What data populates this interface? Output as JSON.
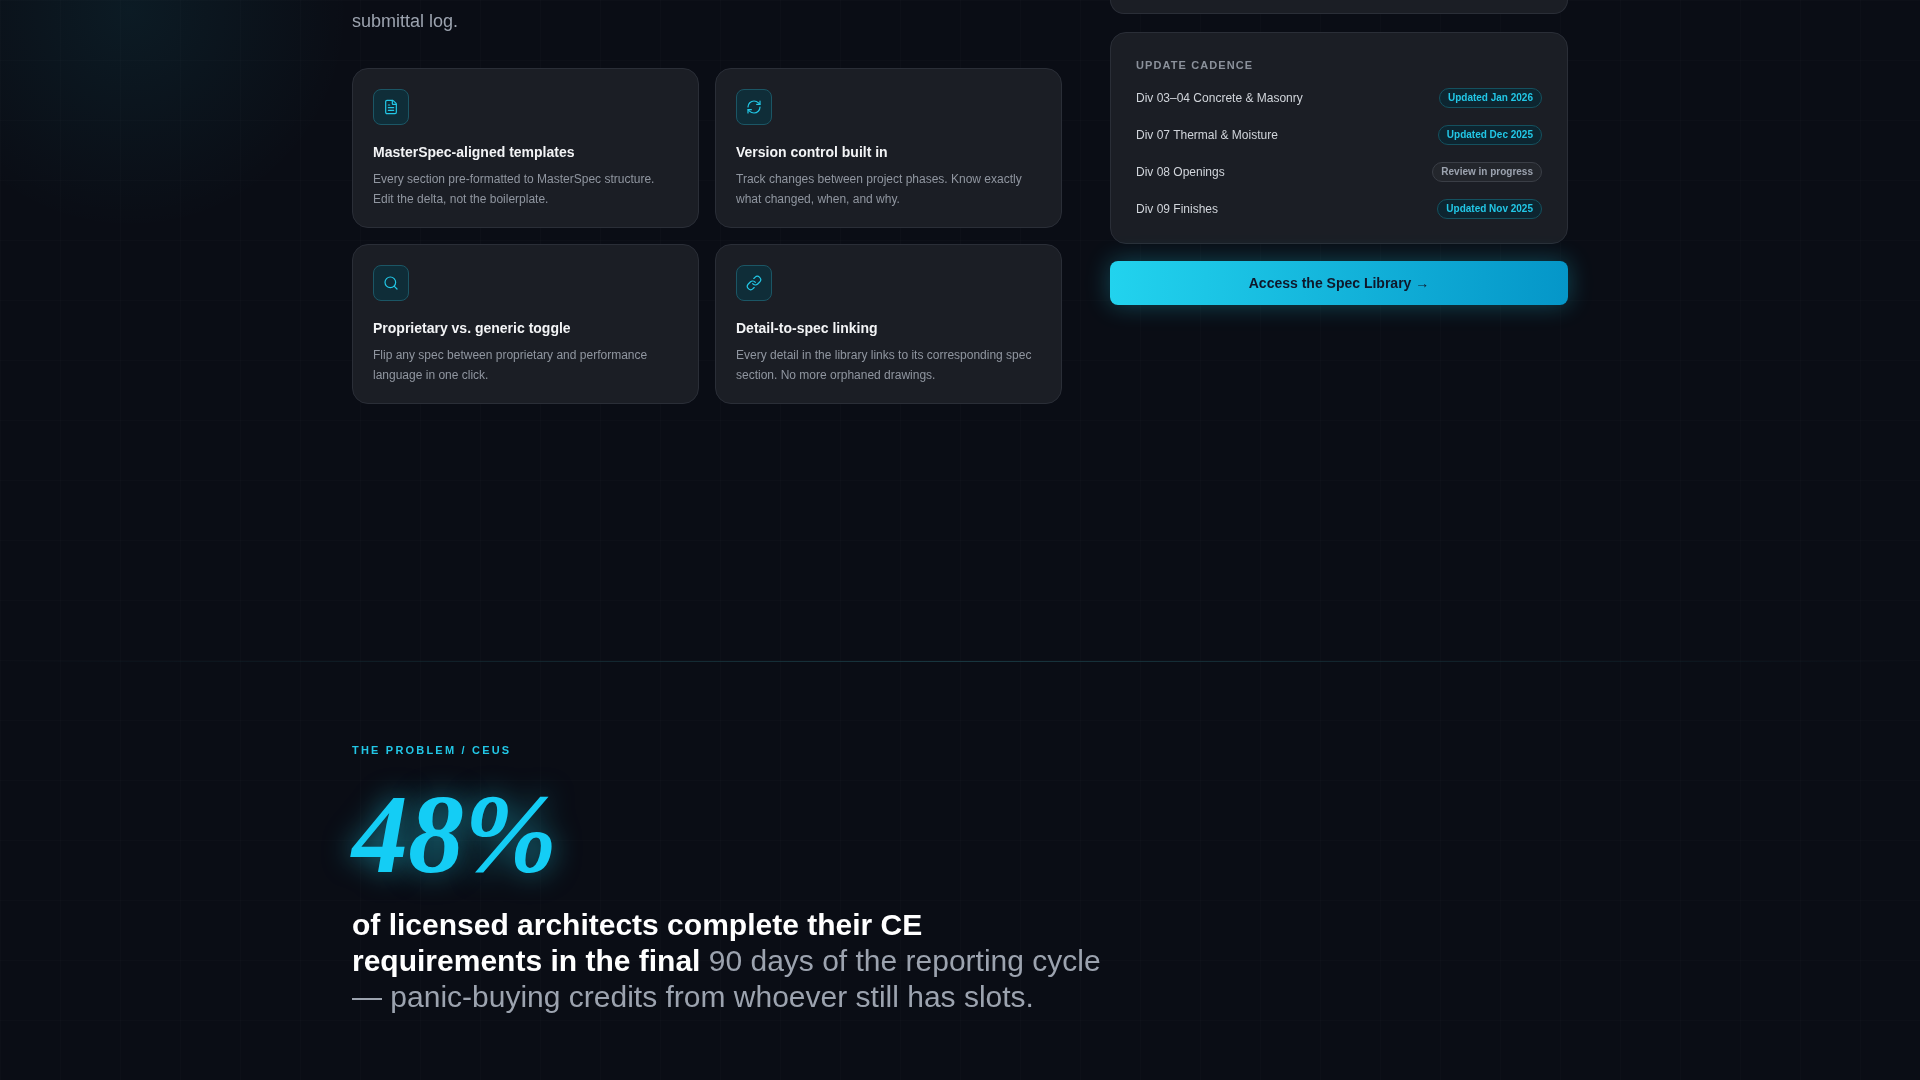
{
  "intro": {
    "text": "submittal log."
  },
  "features": [
    {
      "title": "MasterSpec-aligned templates",
      "description": "Every section pre-formatted to MasterSpec structure. Edit the delta, not the boilerplate."
    },
    {
      "title": "Version control built in",
      "description": "Track changes between project phases. Know exactly what changed, when, and why."
    },
    {
      "title": "Proprietary vs. generic toggle",
      "description": "Flip any spec between proprietary and performance language in one click."
    },
    {
      "title": "Detail-to-spec linking",
      "description": "Every detail in the library links to its corresponding spec section. No more orphaned drawings."
    }
  ],
  "update_cadence": {
    "heading": "UPDATE CADENCE",
    "rows": [
      {
        "division": "Div 03–04 Concrete & Masonry",
        "kind": "updated",
        "badge": "Updated Jan 2026"
      },
      {
        "division": "Div 07 Thermal & Moisture",
        "kind": "updated",
        "badge": "Updated Dec 2025"
      },
      {
        "division": "Div 08 Openings",
        "kind": "review",
        "badge": "Review in progress"
      },
      {
        "division": "Div 09 Finishes",
        "kind": "updated",
        "badge": "Updated Nov 2025"
      }
    ]
  },
  "cta_button": {
    "label": "Access the Spec Library →"
  },
  "problem_section": {
    "eyebrow": "THE PROBLEM / CEUS",
    "stat": "48%",
    "description": "**of licensed architects complete their CE requirements in the final** 90 days of the reporting cycle — panic-buying credits from whoever still has slots."
  }
}
